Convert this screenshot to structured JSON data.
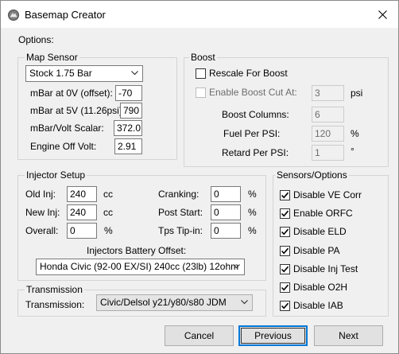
{
  "window": {
    "title": "Basemap Creator",
    "close_glyph": "✕",
    "icon": "app-icon"
  },
  "options_label": "Options:",
  "map_sensor": {
    "legend": "Map Sensor",
    "sensor_select": "Stock 1.75 Bar",
    "rows": [
      {
        "label": "mBar at 0V (offset):",
        "value": "-70"
      },
      {
        "label": "mBar at 5V (11.26psi):",
        "value": "790"
      },
      {
        "label": "mBar/Volt Scalar:",
        "value": "372.0"
      },
      {
        "label": "Engine Off Volt:",
        "value": "2.91"
      }
    ]
  },
  "boost": {
    "legend": "Boost",
    "rescale_label": "Rescale For Boost",
    "rescale_checked": false,
    "cut_label": "Enable Boost Cut At:",
    "cut_value": "3",
    "cut_unit": "psi",
    "columns_label": "Boost Columns:",
    "columns_value": "6",
    "fuel_label": "Fuel Per PSI:",
    "fuel_value": "120",
    "fuel_unit": "%",
    "retard_label": "Retard Per PSI:",
    "retard_value": "1",
    "retard_unit": "°"
  },
  "injector": {
    "legend": "Injector Setup",
    "old_label": "Old Inj:",
    "old_value": "240",
    "old_unit": "cc",
    "new_label": "New Inj:",
    "new_value": "240",
    "new_unit": "cc",
    "overall_label": "Overall:",
    "overall_value": "0",
    "overall_unit": "%",
    "cranking_label": "Cranking:",
    "cranking_value": "0",
    "cranking_unit": "%",
    "post_label": "Post Start:",
    "post_value": "0",
    "post_unit": "%",
    "tps_label": "Tps Tip-in:",
    "tps_value": "0",
    "tps_unit": "%",
    "battery_label": "Injectors Battery Offset:",
    "battery_select": "Honda Civic (92-00 EX/SI) 240cc (23lb) 12ohm"
  },
  "transmission": {
    "legend": "Transmission",
    "label": "Transmission:",
    "select": "Civic/Delsol y21/y80/s80 JDM"
  },
  "sensors": {
    "legend": "Sensors/Options",
    "items": [
      {
        "label": "Disable VE Corr",
        "checked": true
      },
      {
        "label": "Enable ORFC",
        "checked": true
      },
      {
        "label": "Disable ELD",
        "checked": true
      },
      {
        "label": "Disable PA",
        "checked": true
      },
      {
        "label": "Disable Inj Test",
        "checked": true
      },
      {
        "label": "Disable O2H",
        "checked": true
      },
      {
        "label": "Disable IAB",
        "checked": true
      }
    ]
  },
  "buttons": {
    "cancel": "Cancel",
    "previous": "Previous",
    "next": "Next"
  }
}
